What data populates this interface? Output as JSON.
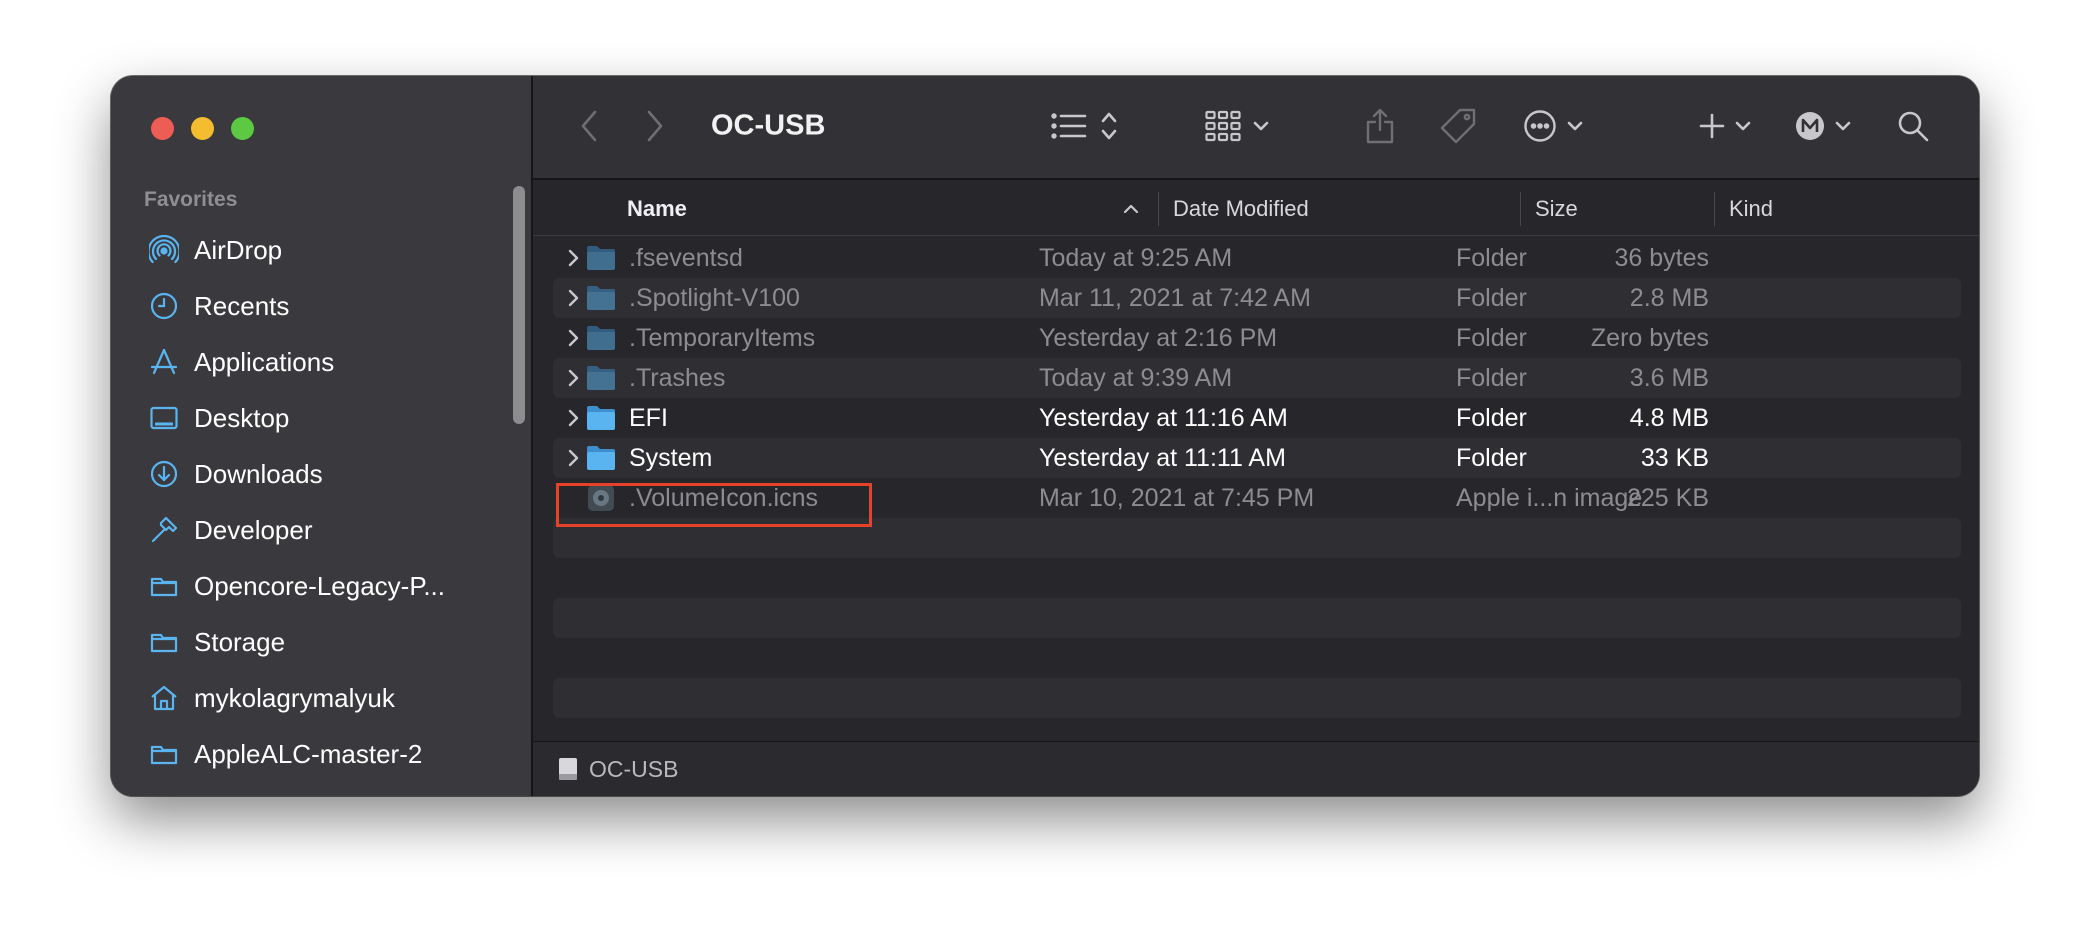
{
  "sidebar": {
    "heading": "Favorites",
    "items": [
      {
        "label": "AirDrop",
        "icon": "airdrop-icon"
      },
      {
        "label": "Recents",
        "icon": "clock-icon"
      },
      {
        "label": "Applications",
        "icon": "applications-icon"
      },
      {
        "label": "Desktop",
        "icon": "desktop-icon"
      },
      {
        "label": "Downloads",
        "icon": "download-icon"
      },
      {
        "label": "Developer",
        "icon": "hammer-icon"
      },
      {
        "label": "Opencore-Legacy-P...",
        "icon": "folder-icon"
      },
      {
        "label": "Storage",
        "icon": "folder-icon"
      },
      {
        "label": "mykolagrymalyuk",
        "icon": "home-icon"
      },
      {
        "label": "AppleALC-master-2",
        "icon": "folder-icon"
      }
    ]
  },
  "toolbar": {
    "title": "OC-USB"
  },
  "columns": {
    "name": "Name",
    "date": "Date Modified",
    "size": "Size",
    "kind": "Kind"
  },
  "files": [
    {
      "name": ".fseventsd",
      "date": "Today at 9:25 AM",
      "size": "36 bytes",
      "kind": "Folder"
    },
    {
      "name": ".Spotlight-V100",
      "date": "Mar 11, 2021 at 7:42 AM",
      "size": "2.8 MB",
      "kind": "Folder"
    },
    {
      "name": ".TemporaryItems",
      "date": "Yesterday at 2:16 PM",
      "size": "Zero bytes",
      "kind": "Folder"
    },
    {
      "name": ".Trashes",
      "date": "Today at 9:39 AM",
      "size": "3.6 MB",
      "kind": "Folder"
    },
    {
      "name": "EFI",
      "date": "Yesterday at 11:16 AM",
      "size": "4.8 MB",
      "kind": "Folder"
    },
    {
      "name": "System",
      "date": "Yesterday at 11:11 AM",
      "size": "33 KB",
      "kind": "Folder"
    },
    {
      "name": ".VolumeIcon.icns",
      "date": "Mar 10, 2021 at 7:45 PM",
      "size": "225 KB",
      "kind": "Apple i...n image"
    }
  ],
  "pathbar": {
    "label": "OC-USB"
  },
  "colors": {
    "accent": "#5ab4f0",
    "highlight": "#e8412a"
  }
}
